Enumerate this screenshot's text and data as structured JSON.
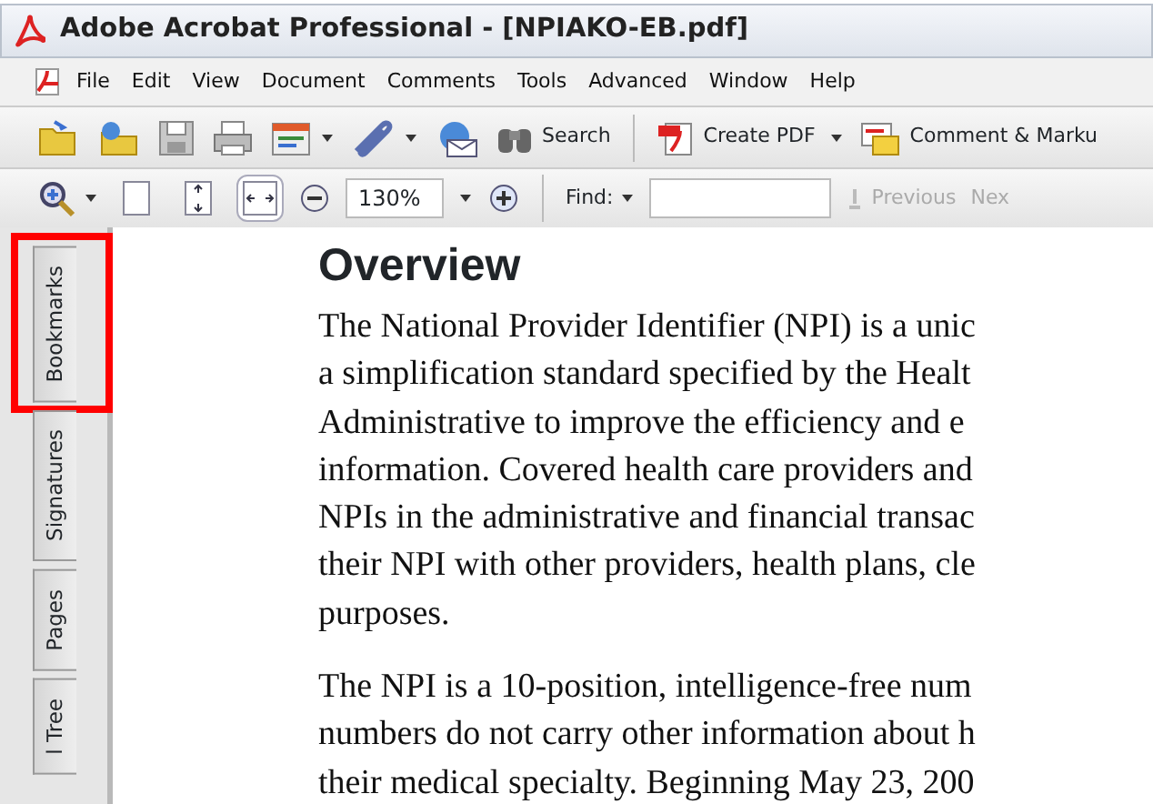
{
  "title_bar": {
    "title": "Adobe Acrobat Professional - [NPIAKO-EB.pdf]"
  },
  "menu_bar": {
    "items": [
      "File",
      "Edit",
      "View",
      "Document",
      "Comments",
      "Tools",
      "Advanced",
      "Window",
      "Help"
    ]
  },
  "file_toolbar": {
    "search_label": "Search",
    "create_pdf_label": "Create PDF",
    "comment_label": "Comment & Marku"
  },
  "view_toolbar": {
    "page_buttons": [
      {
        "selected": false
      },
      {
        "selected": false
      },
      {
        "selected": true
      }
    ],
    "zoom_value": "130%",
    "find_label": "Find:",
    "previous": {
      "label": "Previous",
      "disabled": true
    },
    "next": {
      "label": "Nex",
      "disabled": true
    }
  },
  "side_tabs": [
    {
      "label": "Bookmarks",
      "highlighted": true
    },
    {
      "label": "Signatures",
      "highlighted": false
    },
    {
      "label": "Pages",
      "highlighted": false
    },
    {
      "label": "l Tree",
      "highlighted": false
    }
  ],
  "document": {
    "heading": "Overview",
    "paragraphs": [
      {
        "lines": [
          "The National Provider Identifier (NPI) is a unic",
          "a simplification standard specified by the Healt",
          "Administrative to improve the efficiency and e",
          "information. Covered health care providers and",
          "NPIs in the administrative and financial transac",
          "their NPI with other providers, health plans, cle",
          "purposes."
        ]
      },
      {
        "lines": [
          "The NPI is a 10-position, intelligence-free num",
          "numbers do not carry other information about h",
          "their medical specialty. Beginning May 23, 200"
        ]
      }
    ]
  }
}
